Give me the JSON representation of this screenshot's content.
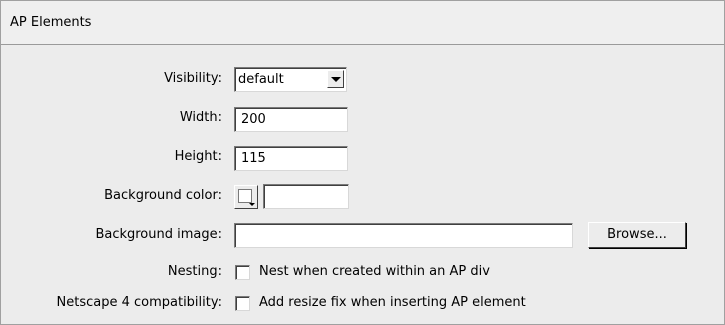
{
  "panel": {
    "title": "AP Elements"
  },
  "fields": {
    "visibility": {
      "label": "Visibility:",
      "value": "default"
    },
    "width": {
      "label": "Width:",
      "value": "200"
    },
    "height": {
      "label": "Height:",
      "value": "115"
    },
    "background_color": {
      "label": "Background color:",
      "value": ""
    },
    "background_image": {
      "label": "Background image:",
      "value": "",
      "browse_label": "Browse..."
    },
    "nesting": {
      "label": "Nesting:",
      "checkbox_label": "Nest when created within an AP div",
      "checked": false
    },
    "netscape": {
      "label": "Netscape 4 compatibility:",
      "checkbox_label": "Add resize fix when inserting AP element",
      "checked": false
    }
  },
  "colors": {
    "panel_bg": "#ececec",
    "field_bg": "#ffffff",
    "border_dark": "#404040"
  },
  "icons": {
    "dropdown": "chevron-down-icon",
    "color_swatch": "color-swatch-icon"
  }
}
